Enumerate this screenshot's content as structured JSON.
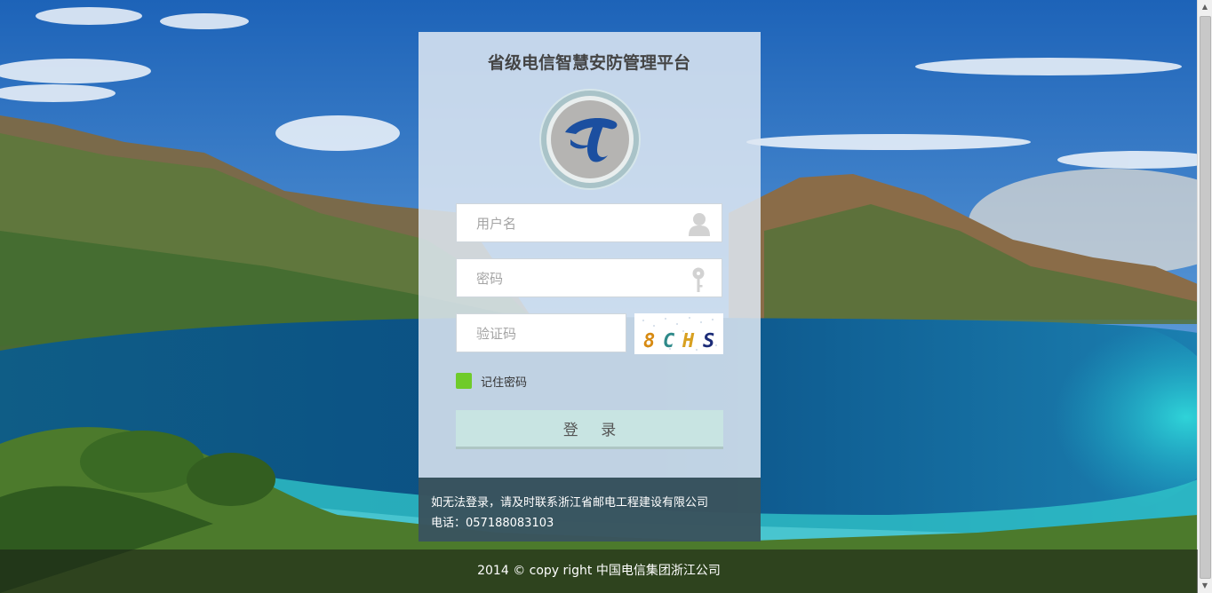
{
  "login": {
    "title": "省级电信智慧安防管理平台",
    "username_placeholder": "用户名",
    "password_placeholder": "密码",
    "captcha_placeholder": "验证码",
    "captcha_text": "8CHS",
    "remember_label": "记住密码",
    "login_button": "登 录",
    "icons": {
      "logo": "china-telecom-logo",
      "username": "user-icon",
      "password": "key-icon"
    }
  },
  "notice": {
    "line1": "如无法登录，请及时联系浙江省邮电工程建设有限公司",
    "line2": "电话：057188083103"
  },
  "footer": {
    "copyright": "2014 © copy right 中国电信集团浙江公司"
  },
  "colors": {
    "remember_checkbox": "#6fcb2a",
    "login_button": "#c8e4e2",
    "notice_background": "#12303a",
    "logo_blue": "#1b4fa0"
  }
}
